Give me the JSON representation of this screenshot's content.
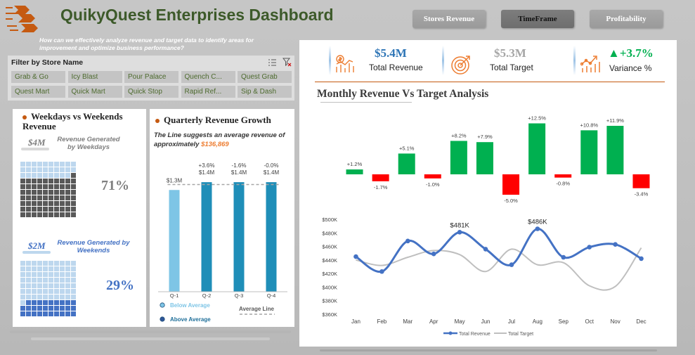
{
  "header": {
    "title": "QuikyQuest Enterprises Dashboard",
    "question": "How can we effectively analyze revenue and target data to identify areas for improvement and optimize business performance?",
    "nav": [
      {
        "label": "Stores Revenue",
        "active": false
      },
      {
        "label": "TimeFrame",
        "active": true
      },
      {
        "label": "Profitability",
        "active": false
      }
    ]
  },
  "filter": {
    "title": "Filter by Store Name",
    "stores": [
      "Grab & Go",
      "Icy Blast",
      "Pour Palace",
      "Quench C...",
      "Quest Grab",
      "Quest Mart",
      "Quick Mart",
      "Quick Stop",
      "Rapid Ref...",
      "Sip & Dash"
    ]
  },
  "weekdays": {
    "title": "Weekdays vs Weekends Revenue",
    "weekday_amount": "$4M",
    "weekday_label": "Revenue Generated by Weekdays",
    "weekday_pct": "71%",
    "weekday_fraction": 0.71,
    "weekend_amount": "$2M",
    "weekend_label": "Revenue Generated by Weekends",
    "weekend_pct": "29%",
    "weekend_fraction": 0.29,
    "colors": {
      "weekday": "#595959",
      "weekday_empty": "#bdd7ee",
      "weekend": "#4472c4",
      "weekend_empty": "#bdd7ee",
      "weekday_pct": "#7f7f7f",
      "weekend_pct": "#4472c4"
    }
  },
  "quarterly": {
    "title": "Quarterly Revenue Growth",
    "note_prefix": "The Line suggests an average revenue of approximately",
    "note_value": "$136,869",
    "legend_below": "Below Average",
    "legend_above": "Above Average",
    "legend_line": "Average Line"
  },
  "kpis": [
    {
      "value": "$5.4M",
      "label": "Total Revenue",
      "icon": "revenue-chart-icon",
      "color": "#2e75b6"
    },
    {
      "value": "$5.3M",
      "label": "Total  Target",
      "icon": "target-icon",
      "color": "#a6a6a6"
    },
    {
      "value": "▲+3.7%",
      "label": "Variance %",
      "icon": "variance-chart-icon",
      "color": "#00b050"
    }
  ],
  "monthly_title": "Monthly Revenue Vs Target Analysis",
  "chart_data": [
    {
      "type": "bar",
      "name": "quarterly",
      "categories": [
        "Q-1",
        "Q-2",
        "Q-3",
        "Q-4"
      ],
      "values": [
        1.3,
        1.4,
        1.4,
        1.4
      ],
      "value_labels": [
        "$1.3M",
        "$1.4M",
        "$1.4M",
        "$1.4M"
      ],
      "growth_labels": [
        "",
        "+3.6%",
        "-1.6%",
        "-0.0%"
      ],
      "average": 1.37,
      "ylim": [
        0,
        1.5
      ],
      "colors": {
        "below": "#7ec5e6",
        "above": "#1f8eb8",
        "avg_line": "#a6a6a6"
      }
    },
    {
      "type": "bar",
      "name": "variance",
      "categories": [
        "Jan",
        "Feb",
        "Mar",
        "Apr",
        "May",
        "Jun",
        "Jul",
        "Aug",
        "Sep",
        "Oct",
        "Nov",
        "Dec"
      ],
      "values": [
        1.2,
        -1.7,
        5.1,
        -1.0,
        8.2,
        7.9,
        -5.0,
        12.5,
        -0.8,
        10.8,
        11.9,
        -3.4
      ],
      "labels": [
        "+1.2%",
        "-1.7%",
        "+5.1%",
        "-1.0%",
        "+8.2%",
        "+7.9%",
        "-5.0%",
        "+12.5%",
        "-0.8%",
        "+10.8%",
        "+11.9%",
        "-3.4%"
      ],
      "colors": {
        "positive": "#00b050",
        "negative": "#ff0000"
      }
    },
    {
      "type": "line",
      "name": "monthly",
      "categories": [
        "Jan",
        "Feb",
        "Mar",
        "Apr",
        "May",
        "Jun",
        "Jul",
        "Aug",
        "Sep",
        "Oct",
        "Nov",
        "Dec"
      ],
      "yticks": [
        "$360K",
        "$380K",
        "$400K",
        "$420K",
        "$440K",
        "$460K",
        "$480K",
        "$500K"
      ],
      "ylim": [
        360,
        500
      ],
      "series": [
        {
          "name": "Total Revenue",
          "values": [
            445,
            423,
            468,
            449,
            481,
            456,
            433,
            486,
            444,
            459,
            463,
            442
          ],
          "color": "#4472c4"
        },
        {
          "name": "Total Target",
          "values": [
            440,
            432,
            444,
            454,
            448,
            423,
            456,
            433,
            436,
            402,
            401,
            458
          ],
          "color": "#bfbfbf"
        }
      ],
      "annotations": [
        {
          "index": 4,
          "text": "$481K"
        },
        {
          "index": 7,
          "text": "$486K"
        }
      ]
    }
  ]
}
